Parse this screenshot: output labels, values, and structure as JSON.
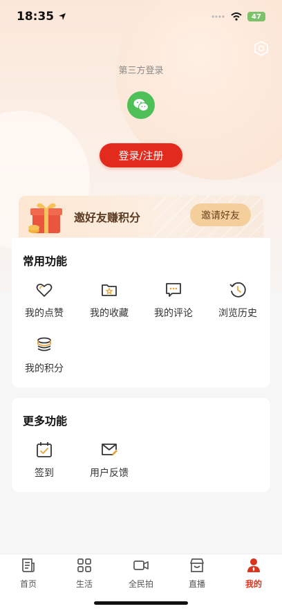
{
  "status_bar": {
    "time": "18:35",
    "battery": "47"
  },
  "login": {
    "third_party_label": "第三方登录",
    "login_button": "登录/注册"
  },
  "invite": {
    "title": "邀好友赚积分",
    "button": "邀请好友"
  },
  "common_functions": {
    "title": "常用功能",
    "items": [
      {
        "label": "我的点赞",
        "icon": "heart-icon"
      },
      {
        "label": "我的收藏",
        "icon": "folder-star-icon"
      },
      {
        "label": "我的评论",
        "icon": "comment-icon"
      },
      {
        "label": "浏览历史",
        "icon": "history-icon"
      },
      {
        "label": "我的积分",
        "icon": "coins-icon"
      }
    ]
  },
  "more_functions": {
    "title": "更多功能",
    "items": [
      {
        "label": "签到",
        "icon": "calendar-check-icon"
      },
      {
        "label": "用户反馈",
        "icon": "mail-edit-icon"
      }
    ]
  },
  "tabbar": {
    "items": [
      {
        "label": "首页",
        "icon": "news-icon"
      },
      {
        "label": "生活",
        "icon": "grid-icon"
      },
      {
        "label": "全民拍",
        "icon": "video-camera-icon"
      },
      {
        "label": "直播",
        "icon": "live-store-icon"
      },
      {
        "label": "我的",
        "icon": "user-icon",
        "active": true
      }
    ]
  },
  "colors": {
    "accent": "#e22a1d",
    "active_tab": "#d8341f",
    "wechat": "#4fc057",
    "icon_accent": "#e8a23a"
  }
}
